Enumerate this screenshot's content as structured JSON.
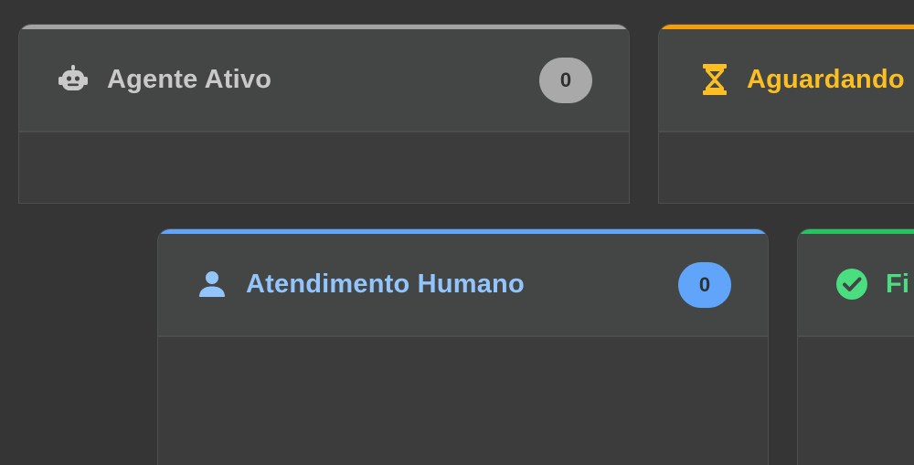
{
  "columns": [
    {
      "key": "agente",
      "title": "Agente Ativo",
      "count": "0",
      "icon": "robot-icon",
      "accent": "#a3a3a3",
      "title_color": "#c9c9c9",
      "badge_color": "#a9a9a9"
    },
    {
      "key": "aguardando",
      "title": "Aguardando",
      "count": "",
      "icon": "hourglass-icon",
      "accent": "#f59e0b",
      "title_color": "#fbbf24",
      "badge_color": "#f59e0b"
    },
    {
      "key": "humano",
      "title": "Atendimento Humano",
      "count": "0",
      "icon": "user-icon",
      "accent": "#60a5fa",
      "title_color": "#93c5fd",
      "badge_color": "#60a5fa"
    },
    {
      "key": "finalizado",
      "title": "Fi",
      "count": "",
      "icon": "check-circle-icon",
      "accent": "#22c55e",
      "title_color": "#4ade80",
      "badge_color": "#22c55e"
    }
  ]
}
